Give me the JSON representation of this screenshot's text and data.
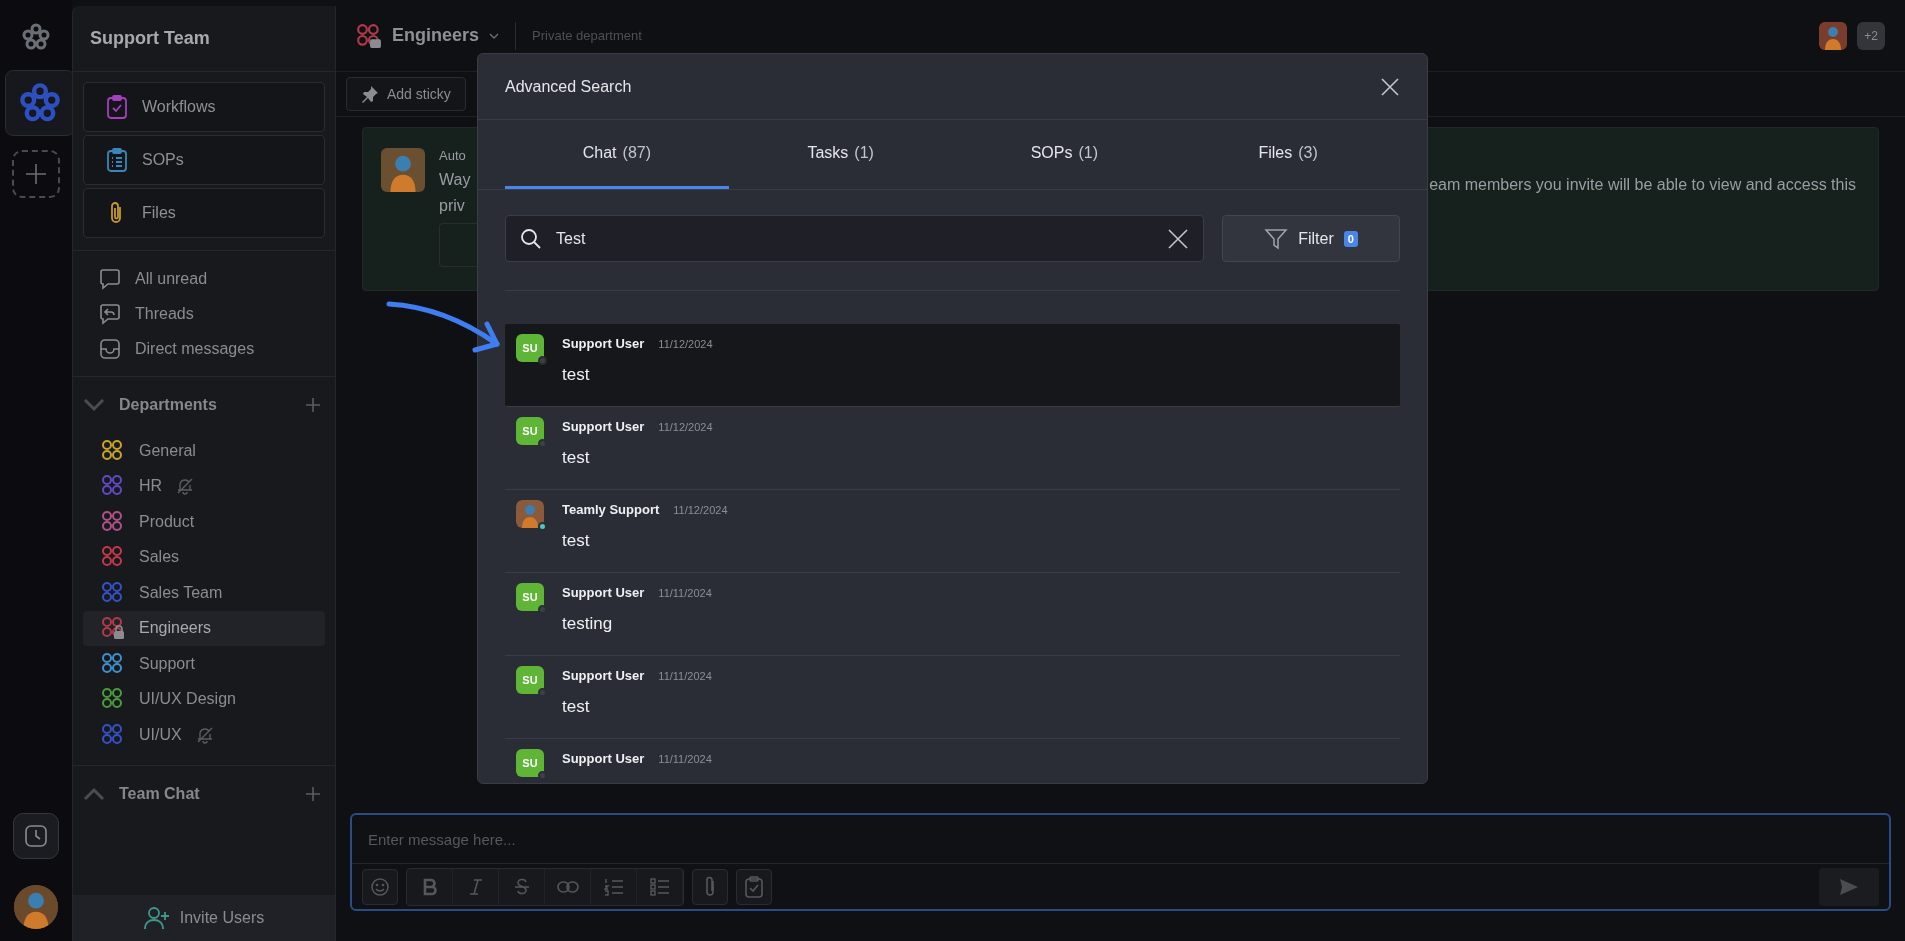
{
  "sidebar": {
    "title": "Support Team",
    "shortcuts": [
      {
        "label": "Workflows",
        "kind": "workflows"
      },
      {
        "label": "SOPs",
        "kind": "sops"
      },
      {
        "label": "Files",
        "kind": "files"
      }
    ],
    "nav": [
      {
        "label": "All unread",
        "kind": "unread"
      },
      {
        "label": "Threads",
        "kind": "threads"
      },
      {
        "label": "Direct messages",
        "kind": "direct"
      }
    ],
    "departments": {
      "title": "Departments",
      "expanded": true,
      "items": [
        {
          "name": "General",
          "color": "#c9a227",
          "muted": false,
          "private": false,
          "selected": false
        },
        {
          "name": "HR",
          "color": "#6248c8",
          "muted": true,
          "private": false,
          "selected": false
        },
        {
          "name": "Product",
          "color": "#b0508a",
          "muted": false,
          "private": false,
          "selected": false
        },
        {
          "name": "Sales",
          "color": "#c0394b",
          "muted": false,
          "private": false,
          "selected": false
        },
        {
          "name": "Sales Team",
          "color": "#3550c8",
          "muted": false,
          "private": false,
          "selected": false
        },
        {
          "name": "Engineers",
          "color": "#b03a48",
          "muted": false,
          "private": true,
          "selected": true
        },
        {
          "name": "Support",
          "color": "#3f8fc9",
          "muted": false,
          "private": false,
          "selected": false
        },
        {
          "name": "UI/UX Design",
          "color": "#4b9a3c",
          "muted": false,
          "private": false,
          "selected": false
        },
        {
          "name": "UI/UX",
          "color": "#3550c8",
          "muted": true,
          "private": false,
          "selected": false
        }
      ]
    },
    "team_chat": {
      "title": "Team Chat",
      "expanded": false
    },
    "invite": "Invite Users"
  },
  "header": {
    "channel": "Engineers",
    "subtitle": "Private department",
    "members_extra": "+2"
  },
  "toolbar": {
    "add_sticky": "Add sticky"
  },
  "banner": {
    "title_fragment": "Auto",
    "line_fragments": [
      "Way",
      "priv"
    ],
    "right_text": "eam members you invite will be able to view and access this"
  },
  "modal": {
    "title": "Advanced Search",
    "tabs": [
      {
        "label": "Chat",
        "count": "(87)",
        "selected": true
      },
      {
        "label": "Tasks",
        "count": "(1)",
        "selected": false
      },
      {
        "label": "SOPs",
        "count": "(1)",
        "selected": false
      },
      {
        "label": "Files",
        "count": "(3)",
        "selected": false
      }
    ],
    "search": {
      "value": "Test"
    },
    "filter": {
      "label": "Filter",
      "count": "0"
    },
    "results": [
      {
        "author": "Support User",
        "initials": "SU",
        "online": false,
        "date": "11/12/2024",
        "text": "test",
        "selected": true
      },
      {
        "author": "Support User",
        "initials": "SU",
        "online": false,
        "date": "11/12/2024",
        "text": "test",
        "selected": false
      },
      {
        "author": "Teamly Support",
        "online": true,
        "date": "11/12/2024",
        "text": "test",
        "selected": false
      },
      {
        "author": "Support User",
        "initials": "SU",
        "online": false,
        "date": "11/11/2024",
        "text": "testing",
        "selected": false
      },
      {
        "author": "Support User",
        "initials": "SU",
        "online": false,
        "date": "11/11/2024",
        "text": "test",
        "selected": false
      },
      {
        "author": "Support User",
        "initials": "SU",
        "online": false,
        "date": "11/11/2024",
        "selected": false
      }
    ]
  },
  "composer": {
    "placeholder": "Enter message here..."
  }
}
